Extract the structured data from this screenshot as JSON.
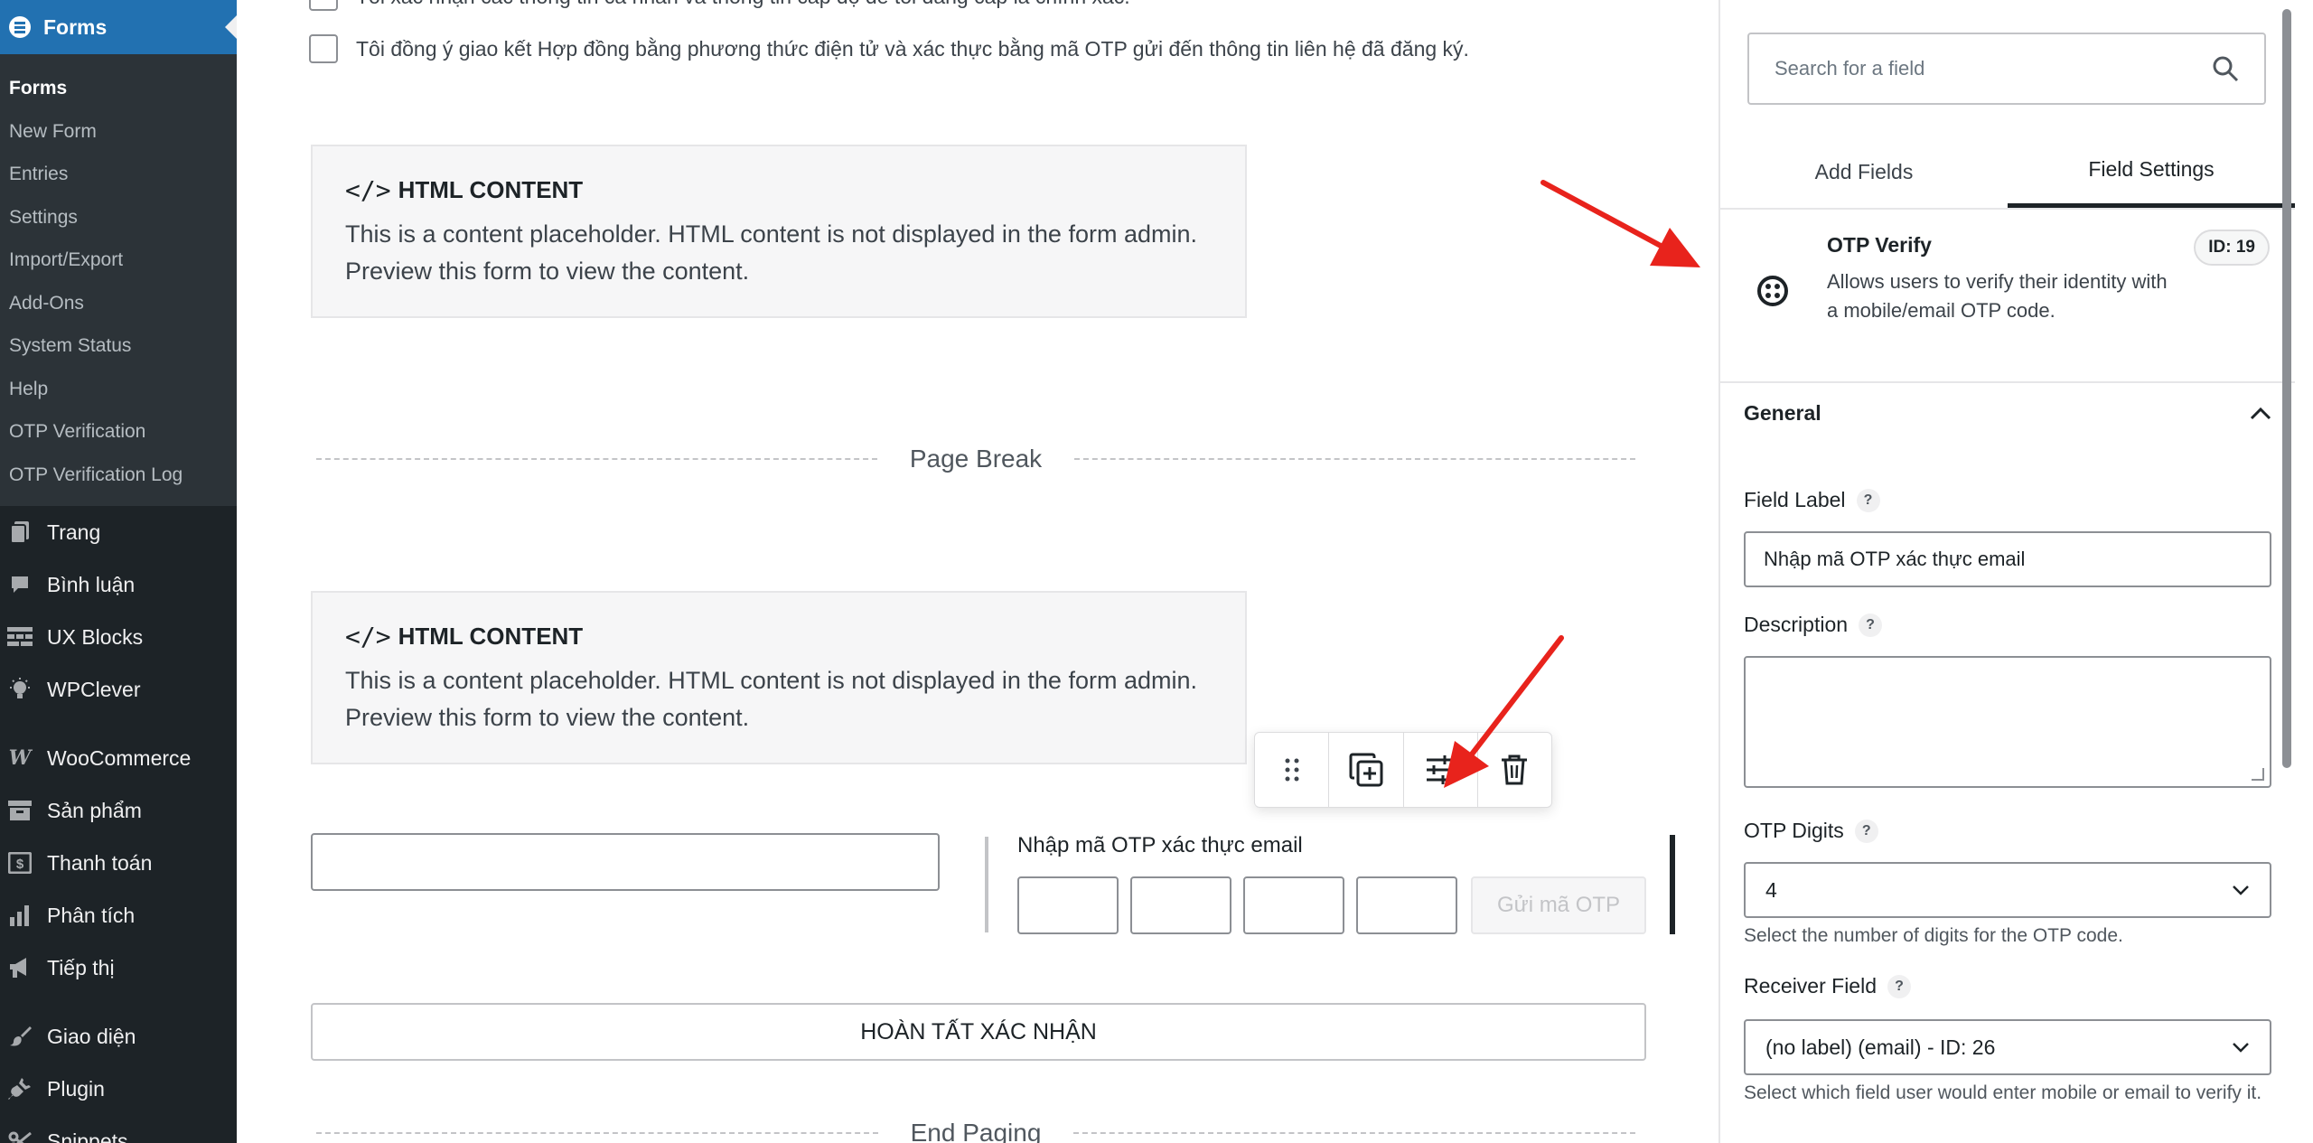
{
  "sidebar": {
    "forms_label": "Forms",
    "submenu": [
      {
        "label": "Forms",
        "active": true
      },
      {
        "label": "New Form"
      },
      {
        "label": "Entries"
      },
      {
        "label": "Settings"
      },
      {
        "label": "Import/Export"
      },
      {
        "label": "Add-Ons"
      },
      {
        "label": "System Status"
      },
      {
        "label": "Help"
      },
      {
        "label": "OTP Verification"
      },
      {
        "label": "OTP Verification Log"
      }
    ],
    "menu": [
      {
        "label": "Trang",
        "icon": "pages-icon"
      },
      {
        "label": "Bình luận",
        "icon": "comments-icon"
      },
      {
        "label": "UX Blocks",
        "icon": "blocks-icon"
      },
      {
        "label": "WPClever",
        "icon": "wpclever-icon"
      },
      {
        "label": "WooCommerce",
        "icon": "woocommerce-icon"
      },
      {
        "label": "Sản phẩm",
        "icon": "products-icon"
      },
      {
        "label": "Thanh toán",
        "icon": "payments-icon"
      },
      {
        "label": "Phân tích",
        "icon": "analytics-icon"
      },
      {
        "label": "Tiếp thị",
        "icon": "marketing-icon"
      },
      {
        "label": "Giao diện",
        "icon": "appearance-icon"
      },
      {
        "label": "Plugin",
        "icon": "plugins-icon"
      },
      {
        "label": "Snippets",
        "icon": "snippets-icon"
      }
    ]
  },
  "form": {
    "consent_top": "Tôi xác nhận các thông tin cá nhân và thông tin cấp độ để tôi đăng cấp là chính xác.",
    "consent_text": "Tôi đồng ý giao kết Hợp đồng bằng phương thức điện tử và xác thực bằng mã OTP gửi đến thông tin liên hệ đã đăng ký.",
    "html_block_1": {
      "title": "HTML CONTENT",
      "body": "This is a content placeholder. HTML content is not displayed in the form admin. Preview this form to view the content."
    },
    "page_break_label": "Page Break",
    "html_block_2": {
      "title": "HTML CONTENT",
      "body": "This is a content placeholder. HTML content is not displayed in the form admin. Preview this form to view the content."
    },
    "otp_field_label": "Nhập mã OTP xác thực email",
    "otp_digits_shown": 4,
    "send_otp_label": "Gửi mã OTP",
    "submit_label": "HOÀN TẤT XÁC NHẬN",
    "end_paging_label": "End Paging"
  },
  "panel": {
    "search_placeholder": "Search for a field",
    "tabs": [
      {
        "label": "Add Fields",
        "active": false
      },
      {
        "label": "Field Settings",
        "active": true
      }
    ],
    "field_card": {
      "title": "OTP Verify",
      "description": "Allows users to verify their identity with a mobile/email OTP code.",
      "id_badge": "ID: 19"
    },
    "general_label": "General",
    "field_label_title": "Field Label",
    "field_label_value": "Nhập mã OTP xác thực email",
    "description_title": "Description",
    "otp_digits_title": "OTP Digits",
    "otp_digits_value": "4",
    "otp_digits_hint": "Select the number of digits for the OTP code.",
    "receiver_title": "Receiver Field",
    "receiver_value": "(no label) (email) - ID: 26",
    "receiver_hint": "Select which field user would enter mobile or email to verify it."
  },
  "colors": {
    "admin_bar": "#1d2327",
    "accent": "#2271b1",
    "arrow": "#e8231c"
  }
}
